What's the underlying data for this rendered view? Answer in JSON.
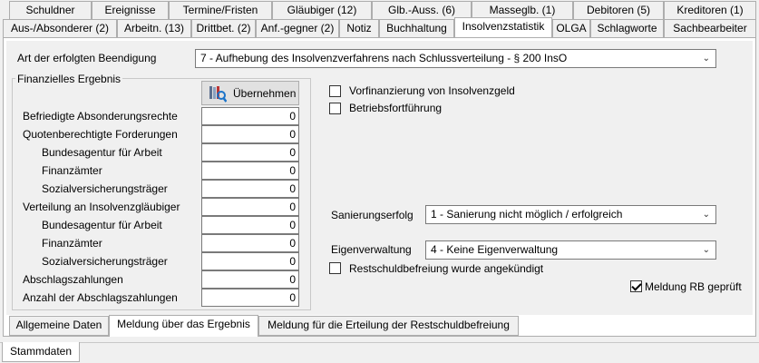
{
  "tabs_row1": [
    "Schuldner",
    "Ereignisse",
    "Termine/Fristen",
    "Gläubiger (12)",
    "Glb.-Auss. (6)",
    "Masseglb. (1)",
    "Debitoren (5)",
    "Kreditoren (1)"
  ],
  "tabs_row2": [
    "Aus-/Absonderer (2)",
    "Arbeitn. (13)",
    "Drittbet. (2)",
    "Anf.-gegner (2)",
    "Notiz",
    "Buchhaltung",
    "Insolvenzstatistik",
    "OLGA",
    "Schlagworte",
    "Sachbearbeiter"
  ],
  "beendigung": {
    "label": "Art der erfolgten Beendigung",
    "value": "7 - Aufhebung des Insolvenzverfahrens nach Schlussverteilung - § 200 InsO"
  },
  "finanz": {
    "title": "Finanzielles Ergebnis",
    "button_label": "Übernehmen",
    "rows": [
      {
        "label": "Befriedigte Absonderungsrechte",
        "value": "0"
      },
      {
        "label": "Quotenberechtigte Forderungen",
        "value": "0"
      },
      {
        "label": "Bundesagentur für Arbeit",
        "value": "0"
      },
      {
        "label": "Finanzämter",
        "value": "0"
      },
      {
        "label": "Sozialversicherungsträger",
        "value": "0"
      },
      {
        "label": "Verteilung an Insolvenzgläubiger",
        "value": "0"
      },
      {
        "label": "Bundesagentur für Arbeit",
        "value": "0"
      },
      {
        "label": "Finanzämter",
        "value": "0"
      },
      {
        "label": "Sozialversicherungsträger",
        "value": "0"
      },
      {
        "label": "Abschlagszahlungen",
        "value": "0"
      },
      {
        "label": "Anzahl der Abschlagszahlungen",
        "value": "0"
      }
    ]
  },
  "checks": {
    "vorfinanzierung": "Vorfinanzierung von Insolvenzgeld",
    "betriebsfortfuehrung": "Betriebsfortführung",
    "restschuld": "Restschuldbefreiung wurde angekündigt",
    "meldung_rb": "Meldung RB geprüft"
  },
  "sanierung": {
    "label": "Sanierungserfolg",
    "value": "1 - Sanierung nicht möglich / erfolgreich"
  },
  "eigenverwaltung": {
    "label": "Eigenverwaltung",
    "value": "4 - Keine Eigenverwaltung"
  },
  "bottom_tabs": [
    "Allgemeine Daten",
    "Meldung über das Ergebnis",
    "Meldung für die Erteilung der Restschuldbefreiung"
  ],
  "footer_tab": "Stammdaten",
  "colors": {
    "border": "#adadad",
    "background": "#f0f0f0"
  }
}
